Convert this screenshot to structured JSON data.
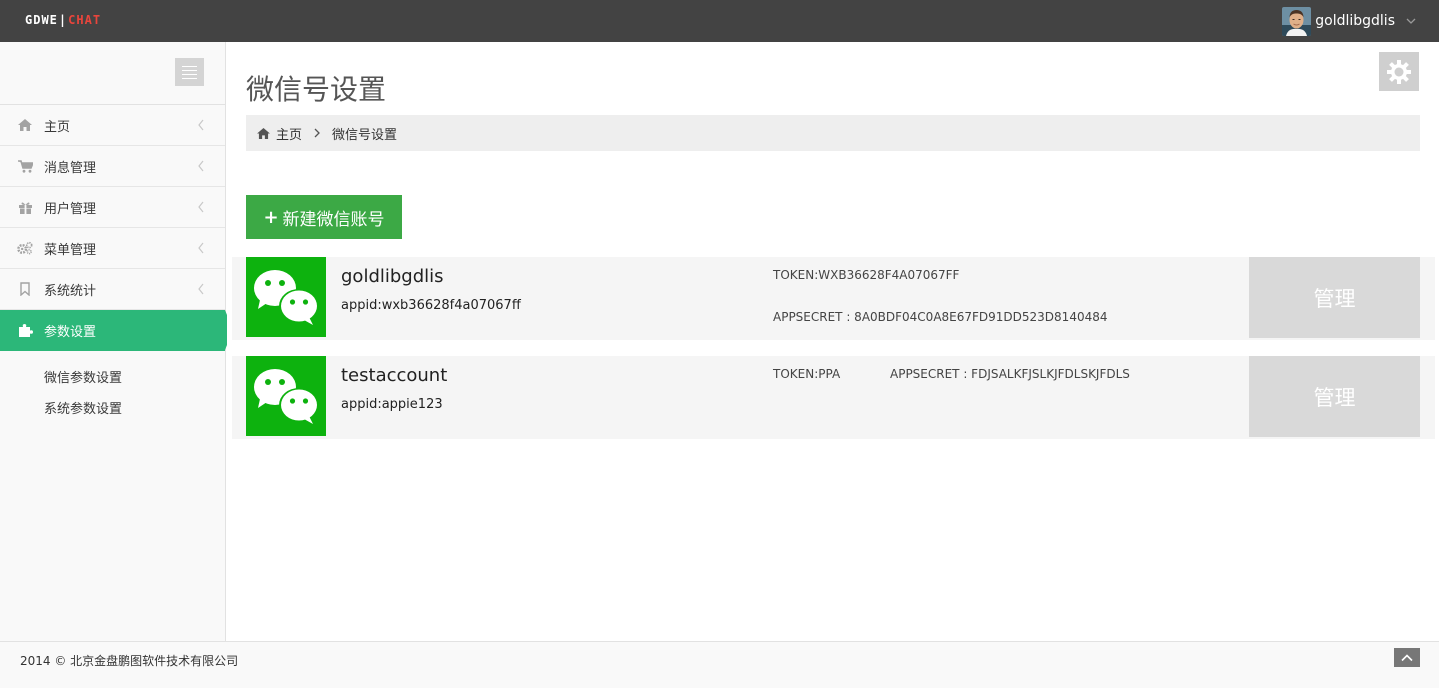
{
  "app": {
    "logo_part1": "GDWE",
    "logo_sep": "|",
    "logo_part2": "CHAT"
  },
  "user": {
    "name": "goldlibgdlis"
  },
  "sidebar": {
    "items": [
      {
        "label": "主页",
        "icon": "home-icon"
      },
      {
        "label": "消息管理",
        "icon": "cart-icon"
      },
      {
        "label": "用户管理",
        "icon": "gift-icon"
      },
      {
        "label": "菜单管理",
        "icon": "cogs-icon"
      },
      {
        "label": "系统统计",
        "icon": "bookmark-icon"
      },
      {
        "label": "参数设置",
        "icon": "puzzle-icon",
        "active": true
      }
    ],
    "submenu": [
      {
        "label": "微信参数设置"
      },
      {
        "label": "系统参数设置"
      }
    ]
  },
  "main": {
    "title": "微信号设置",
    "breadcrumb": {
      "home": "主页",
      "current": "微信号设置"
    },
    "new_button": {
      "plus": "+",
      "label": "新建微信账号"
    },
    "accounts": [
      {
        "name": "goldlibgdlis",
        "appid": "appid:wxb36628f4a07067ff",
        "token": "TOKEN:WXB36628F4A07067FF",
        "appsecret": "APPSECRET : 8A0BDF04C0A8E67FD91DD523D8140484",
        "manage_label": "管理"
      },
      {
        "name": "testaccount",
        "appid": "appid:appie123",
        "token": "TOKEN:PPA",
        "appsecret": "APPSECRET : FDJSALKFJSLKJFDLSKJFDLS",
        "manage_label": "管理"
      }
    ]
  },
  "footer": {
    "copyright": "2014 © 北京金盘鹏图软件技术有限公司"
  },
  "colors": {
    "topbar": "#434343",
    "logo_accent": "#e8453c",
    "active_menu": "#2cb779",
    "new_button": "#3ca945",
    "wechat_green": "#0db20e",
    "manage_button": "#d9d9d9"
  }
}
